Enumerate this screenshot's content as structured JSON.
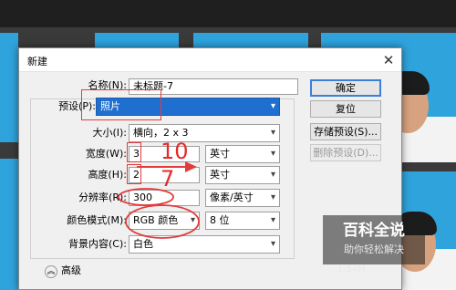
{
  "dialog": {
    "title": "新建",
    "close": "✕",
    "fields": {
      "name_label": "名称(N):",
      "name_value": "未标题-7",
      "preset_label": "预设(P):",
      "preset_value": "照片",
      "size_label": "大小(I):",
      "size_value": "横向，2 x 3",
      "width_label": "宽度(W):",
      "width_value": "3",
      "width_unit": "英寸",
      "height_label": "高度(H):",
      "height_value": "2",
      "height_unit": "英寸",
      "resolution_label": "分辨率(R):",
      "resolution_value": "300",
      "resolution_unit": "像素/英寸",
      "colormode_label": "颜色模式(M):",
      "colormode_value": "RGB 颜色",
      "bitdepth_value": "8 位",
      "background_label": "背景内容(C):",
      "background_value": "白色"
    },
    "advanced_label": "高级",
    "buttons": {
      "ok": "确定",
      "reset": "复位",
      "save_preset": "存储预设(S)...",
      "delete_preset": "删除预设(D)..."
    }
  },
  "annotations": {
    "width_number": "10",
    "height_number": "7"
  },
  "watermark": {
    "title": "百科全说",
    "subtitle": "助你轻松解决"
  },
  "image_size": "1.54M",
  "icons": {
    "close": "close-icon",
    "dropdown": "chevron-down-icon",
    "advanced": "chevron-circle-icon"
  },
  "colors": {
    "annotation": "#e23b3b",
    "selection": "#1f6fd0",
    "photo_background": "#2fa3dc"
  }
}
